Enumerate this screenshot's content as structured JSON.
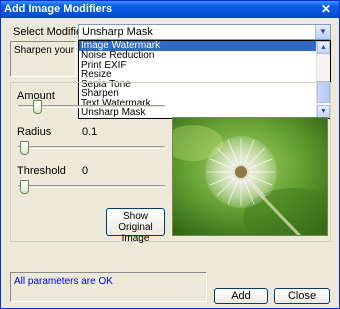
{
  "window": {
    "title": "Add Image Modifiers"
  },
  "modifier": {
    "label": "Select Modifier",
    "selected": "Unsharp Mask",
    "description": "Sharpen your image",
    "options": [
      "Image Watermark",
      "Noise Reduction",
      "Print EXIF",
      "Resize",
      "Sepia Tone",
      "Sharpen",
      "Text Watermark",
      "Unsharp Mask"
    ],
    "highlighted": "Image Watermark"
  },
  "params": {
    "amount_label": "Amount",
    "radius_label": "Radius",
    "radius_value": "0.1",
    "threshold_label": "Threshold",
    "threshold_value": "0"
  },
  "buttons": {
    "show_original": "Show Original Image",
    "add": "Add",
    "close": "Close"
  },
  "status": "All parameters are OK",
  "colors": {
    "selection": "#316ac5",
    "status_text": "#0000ff",
    "titlebar": "#0a5ee7"
  }
}
